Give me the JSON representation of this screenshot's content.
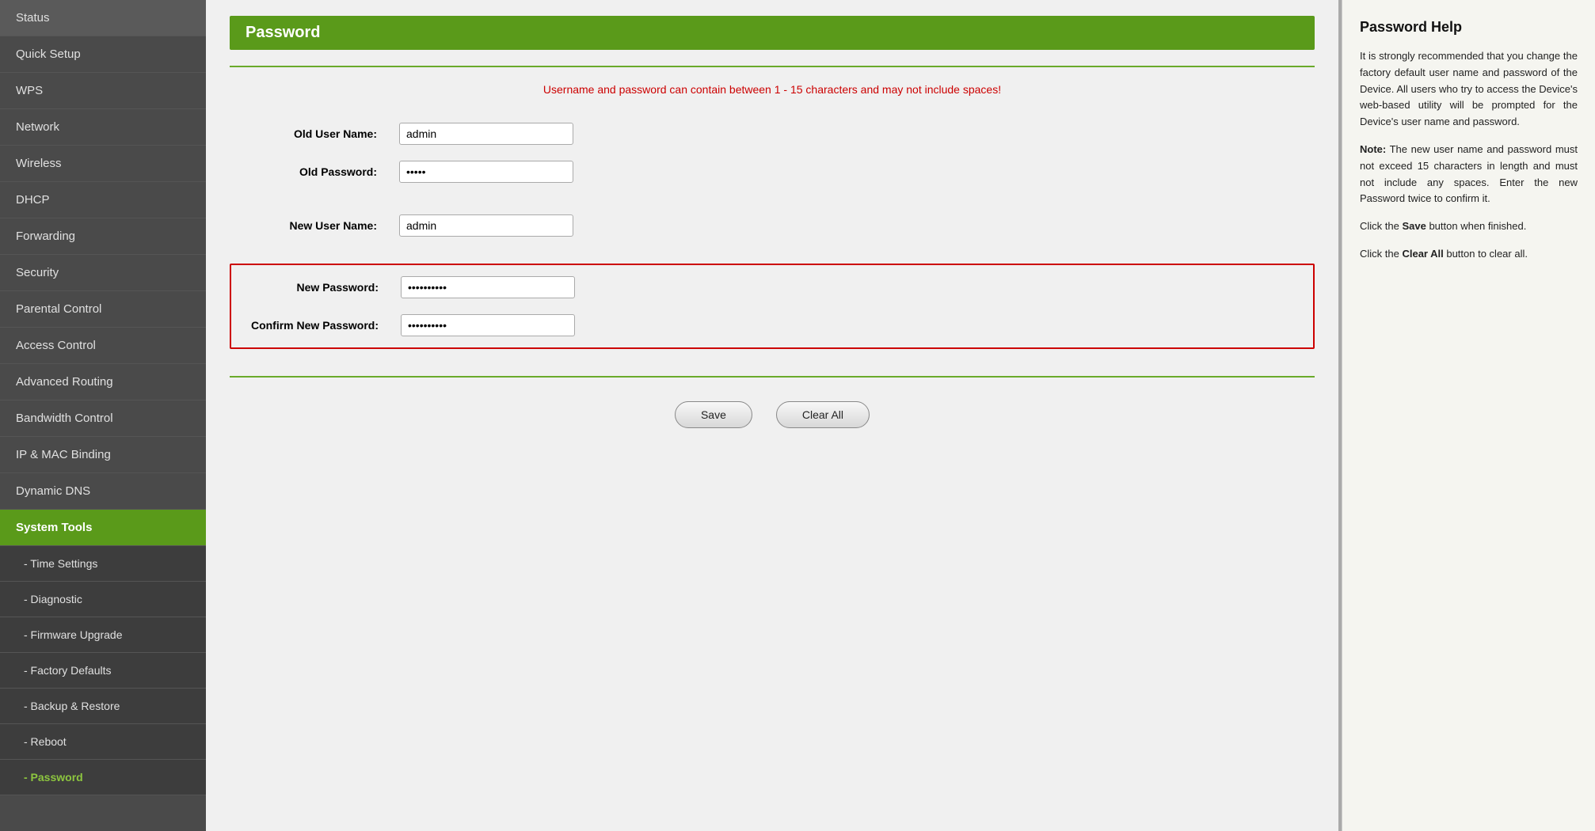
{
  "sidebar": {
    "items": [
      {
        "id": "status",
        "label": "Status",
        "type": "main",
        "active": false
      },
      {
        "id": "quick-setup",
        "label": "Quick Setup",
        "type": "main",
        "active": false
      },
      {
        "id": "wps",
        "label": "WPS",
        "type": "main",
        "active": false
      },
      {
        "id": "network",
        "label": "Network",
        "type": "main",
        "active": false
      },
      {
        "id": "wireless",
        "label": "Wireless",
        "type": "main",
        "active": false
      },
      {
        "id": "dhcp",
        "label": "DHCP",
        "type": "main",
        "active": false
      },
      {
        "id": "forwarding",
        "label": "Forwarding",
        "type": "main",
        "active": false
      },
      {
        "id": "security",
        "label": "Security",
        "type": "main",
        "active": false
      },
      {
        "id": "parental-control",
        "label": "Parental Control",
        "type": "main",
        "active": false
      },
      {
        "id": "access-control",
        "label": "Access Control",
        "type": "main",
        "active": false
      },
      {
        "id": "advanced-routing",
        "label": "Advanced Routing",
        "type": "main",
        "active": false
      },
      {
        "id": "bandwidth-control",
        "label": "Bandwidth Control",
        "type": "main",
        "active": false
      },
      {
        "id": "ip-mac-binding",
        "label": "IP & MAC Binding",
        "type": "main",
        "active": false
      },
      {
        "id": "dynamic-dns",
        "label": "Dynamic DNS",
        "type": "main",
        "active": false
      },
      {
        "id": "system-tools",
        "label": "System Tools",
        "type": "main",
        "active": true
      },
      {
        "id": "time-settings",
        "label": "- Time Settings",
        "type": "sub",
        "active": false
      },
      {
        "id": "diagnostic",
        "label": "- Diagnostic",
        "type": "sub",
        "active": false
      },
      {
        "id": "firmware-upgrade",
        "label": "- Firmware Upgrade",
        "type": "sub",
        "active": false
      },
      {
        "id": "factory-defaults",
        "label": "- Factory Defaults",
        "type": "sub",
        "active": false
      },
      {
        "id": "backup-restore",
        "label": "- Backup & Restore",
        "type": "sub",
        "active": false
      },
      {
        "id": "reboot",
        "label": "- Reboot",
        "type": "sub",
        "active": false
      },
      {
        "id": "password",
        "label": "- Password",
        "type": "sub",
        "active": true
      }
    ]
  },
  "page": {
    "header": "Password",
    "warning": "Username and password can contain between 1 - 15 characters and may not include spaces!",
    "form": {
      "old_username_label": "Old User Name:",
      "old_username_value": "admin",
      "old_password_label": "Old Password:",
      "old_password_value": "•••••",
      "new_username_label": "New User Name:",
      "new_username_value": "admin",
      "new_password_label": "New Password:",
      "new_password_value": "••••••••••",
      "confirm_password_label": "Confirm New Password:",
      "confirm_password_value": "••••••••••"
    },
    "buttons": {
      "save": "Save",
      "clear_all": "Clear All"
    }
  },
  "help": {
    "title": "Password Help",
    "paragraphs": [
      "It is strongly recommended that you change the factory default user name and password of the Device. All users who try to access the Device's web-based utility will be prompted for the Device's user name and password.",
      "Note: The new user name and password must not exceed 15 characters in length and must not include any spaces. Enter the new Password twice to confirm it.",
      "Click the Save button when finished.",
      "Click the Clear All button to clear all."
    ]
  }
}
